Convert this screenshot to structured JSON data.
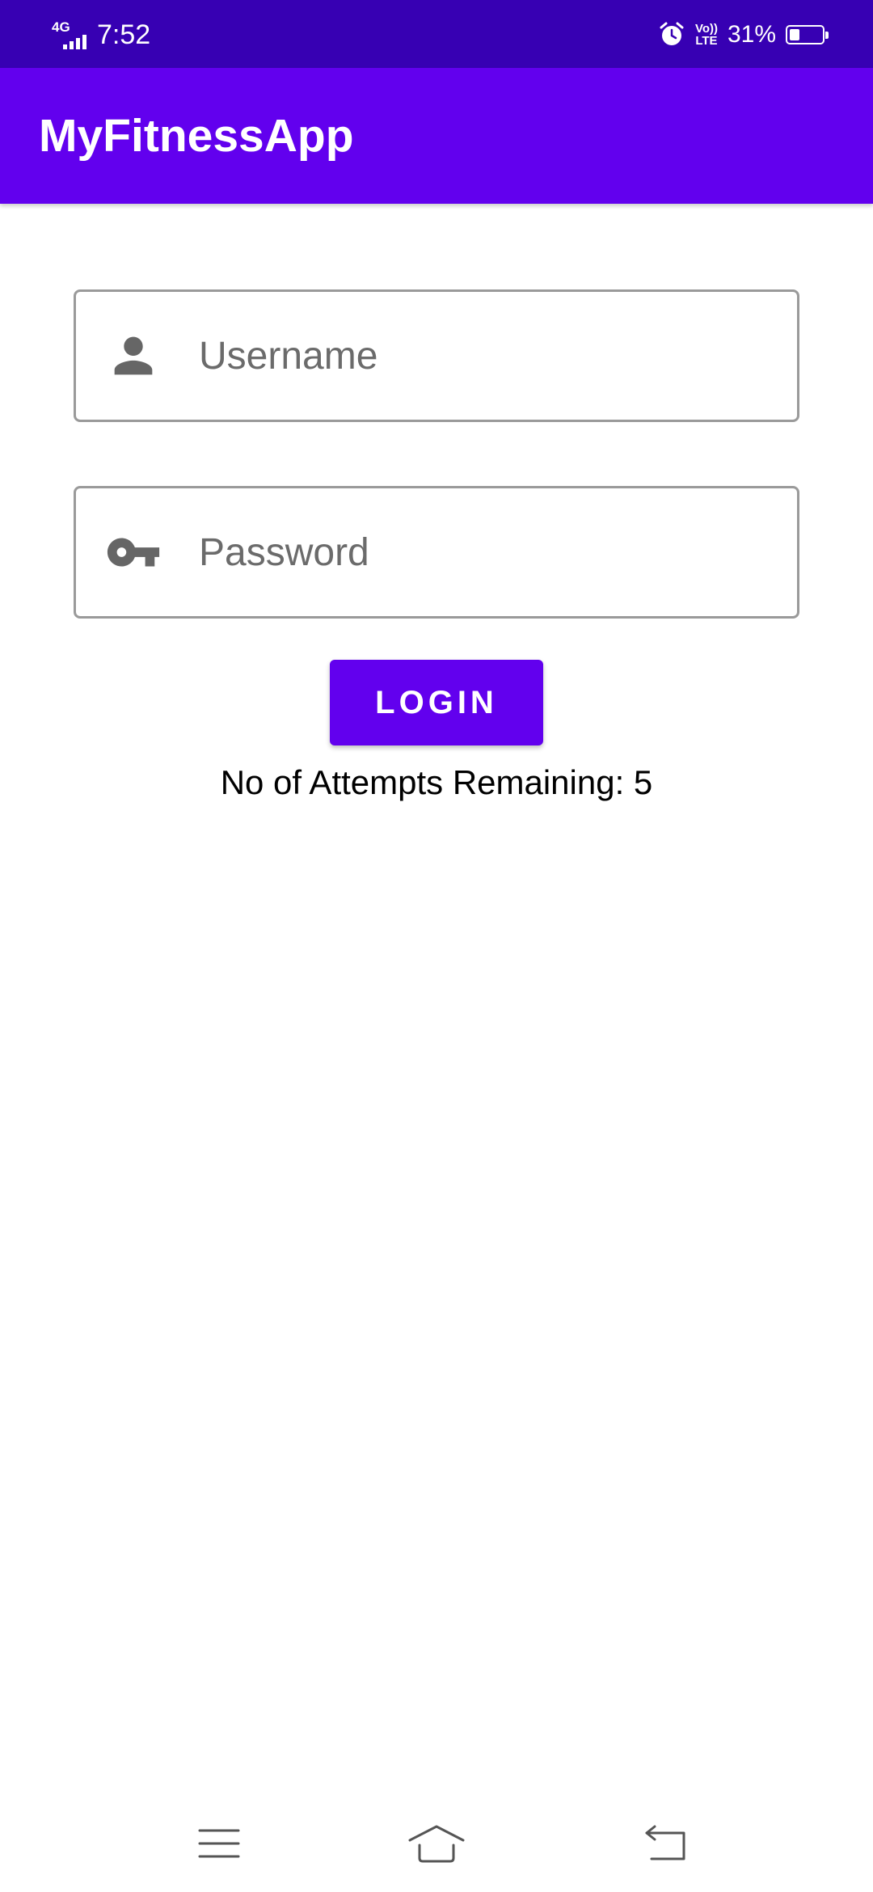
{
  "status_bar": {
    "network": "4G",
    "time": "7:52",
    "volte_top": "Vo))",
    "volte_bottom": "LTE",
    "battery_percent_label": "31%",
    "battery_level": 0.31
  },
  "app_bar": {
    "title": "MyFitnessApp"
  },
  "form": {
    "username": {
      "placeholder": "Username",
      "value": "",
      "icon": "person-icon"
    },
    "password": {
      "placeholder": "Password",
      "value": "",
      "icon": "key-icon"
    },
    "login_label": "LOGIN",
    "attempts_text": "No of Attempts Remaining: 5"
  },
  "nav_bar": {
    "items": [
      "menu-icon",
      "home-icon",
      "back-icon"
    ]
  },
  "colors": {
    "status_bar": "#3700B3",
    "primary": "#6200EE",
    "icon_gray": "#666666",
    "field_border": "#9a9a9a"
  }
}
